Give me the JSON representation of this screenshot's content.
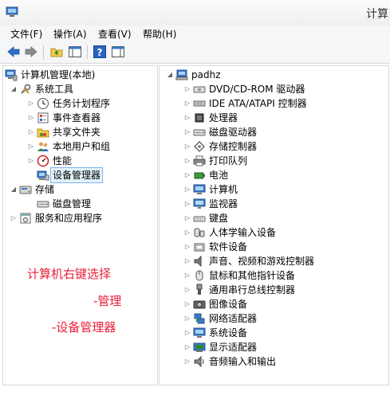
{
  "window": {
    "title": "计算"
  },
  "menu": [
    "文件(F)",
    "操作(A)",
    "查看(V)",
    "帮助(H)"
  ],
  "left_tree": [
    {
      "label": "计算机管理(本地)",
      "depth": 0,
      "arrow": "",
      "icon": "computer-mgmt-icon"
    },
    {
      "label": "系统工具",
      "depth": 1,
      "arrow": "open",
      "icon": "tools-icon"
    },
    {
      "label": "任务计划程序",
      "depth": 2,
      "arrow": "closed",
      "icon": "clock-icon"
    },
    {
      "label": "事件查看器",
      "depth": 2,
      "arrow": "closed",
      "icon": "event-viewer-icon"
    },
    {
      "label": "共享文件夹",
      "depth": 2,
      "arrow": "closed",
      "icon": "shared-folder-icon"
    },
    {
      "label": "本地用户和组",
      "depth": 2,
      "arrow": "closed",
      "icon": "users-icon"
    },
    {
      "label": "性能",
      "depth": 2,
      "arrow": "closed",
      "icon": "performance-icon"
    },
    {
      "label": "设备管理器",
      "depth": 2,
      "arrow": "",
      "icon": "device-manager-icon",
      "selected": true
    },
    {
      "label": "存储",
      "depth": 1,
      "arrow": "open",
      "icon": "storage-icon"
    },
    {
      "label": "磁盘管理",
      "depth": 2,
      "arrow": "",
      "icon": "disk-icon"
    },
    {
      "label": "服务和应用程序",
      "depth": 1,
      "arrow": "closed",
      "icon": "services-icon"
    }
  ],
  "right_tree": {
    "root": "padhz",
    "items": [
      {
        "label": "DVD/CD-ROM 驱动器",
        "icon": "cdrom-icon"
      },
      {
        "label": "IDE ATA/ATAPI 控制器",
        "icon": "ide-controller-icon"
      },
      {
        "label": "处理器",
        "icon": "processor-icon"
      },
      {
        "label": "磁盘驱动器",
        "icon": "disk-drive-icon"
      },
      {
        "label": "存储控制器",
        "icon": "storage-controller-icon"
      },
      {
        "label": "打印队列",
        "icon": "printer-icon"
      },
      {
        "label": "电池",
        "icon": "battery-icon"
      },
      {
        "label": "计算机",
        "icon": "computer-icon"
      },
      {
        "label": "监视器",
        "icon": "monitor-icon"
      },
      {
        "label": "键盘",
        "icon": "keyboard-icon"
      },
      {
        "label": "人体学输入设备",
        "icon": "hid-icon"
      },
      {
        "label": "软件设备",
        "icon": "software-device-icon"
      },
      {
        "label": "声音、视频和游戏控制器",
        "icon": "sound-icon"
      },
      {
        "label": "鼠标和其他指针设备",
        "icon": "mouse-icon"
      },
      {
        "label": "通用串行总线控制器",
        "icon": "usb-icon"
      },
      {
        "label": "图像设备",
        "icon": "camera-icon"
      },
      {
        "label": "网络适配器",
        "icon": "network-adapter-icon"
      },
      {
        "label": "系统设备",
        "icon": "system-device-icon"
      },
      {
        "label": "显示适配器",
        "icon": "display-adapter-icon"
      },
      {
        "label": "音频输入和输出",
        "icon": "audio-io-icon"
      }
    ]
  },
  "annotations": [
    "计算机右键选择",
    "-管理",
    "-设备管理器"
  ],
  "colors": {
    "annotation": "#e8203a",
    "selection": "#e5f3fb",
    "selection_border": "#7eb4ea"
  }
}
